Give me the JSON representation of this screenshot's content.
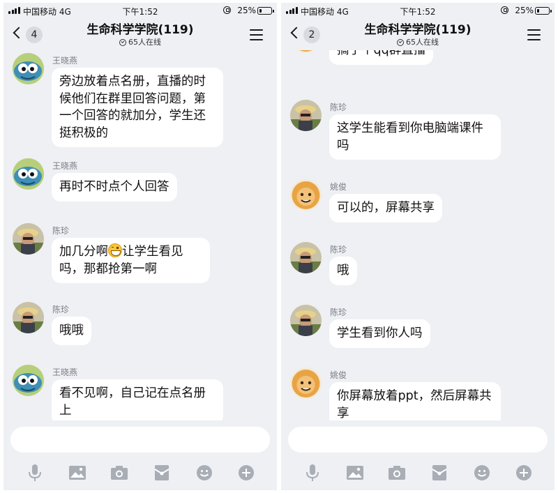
{
  "screens": [
    {
      "status": {
        "carrier": "中国移动 4G",
        "time": "下午1:52",
        "battery": "25%",
        "battery_level": 0.25
      },
      "header": {
        "back_count": "4",
        "title": "生命科学学院(119)",
        "online": "65人在线"
      },
      "input_placeholder": "",
      "messages": [
        {
          "sender": "王晓燕",
          "avatar": "cartoon-bug-avatar",
          "text": "旁边放着点名册，直播的时候他们在群里回答问题，第一个回答的就加分，学生还挺积极的"
        },
        {
          "sender": "王晓燕",
          "avatar": "cartoon-bug-avatar",
          "text": "再时不时点个人回答"
        },
        {
          "sender": "陈珍",
          "avatar": "photo-avatar",
          "text_before": "加几分啊",
          "emoji": "grin-emoji",
          "text_after": "让学生看见吗，那都抢第一啊"
        },
        {
          "sender": "陈珍",
          "avatar": "photo-avatar",
          "text": "哦哦"
        },
        {
          "sender": "王晓燕",
          "avatar": "cartoon-bug-avatar",
          "text": "看不见啊，自己记在点名册上"
        }
      ]
    },
    {
      "status": {
        "carrier": "中国移动 4G",
        "time": "下午1:52",
        "battery": "25%",
        "battery_level": 0.25
      },
      "header": {
        "back_count": "2",
        "title": "生命科学学院(119)",
        "online": "65人在线"
      },
      "input_placeholder": "",
      "messages": [
        {
          "sender": "",
          "avatar": "lion-avatar",
          "text": "搞了个qq群直播"
        },
        {
          "sender": "陈珍",
          "avatar": "photo-avatar",
          "text": "这学生能看到你电脑端课件吗"
        },
        {
          "sender": "姚俊",
          "avatar": "lion-avatar",
          "text": "可以的，屏幕共享"
        },
        {
          "sender": "陈珍",
          "avatar": "photo-avatar",
          "text": "哦"
        },
        {
          "sender": "陈珍",
          "avatar": "photo-avatar",
          "text": "学生看到你人吗"
        },
        {
          "sender": "姚俊",
          "avatar": "lion-avatar",
          "text": "你屏幕放着ppt，然后屏幕共享"
        }
      ]
    }
  ],
  "toolbar_icons": [
    "microphone-icon",
    "image-icon",
    "camera-icon",
    "red-packet-icon",
    "emoji-icon",
    "plus-icon"
  ],
  "colors": {
    "background": "#eef0f4",
    "bubble": "#ffffff",
    "sender": "#7a7d84",
    "toolbar_icon": "#a9adb5"
  }
}
